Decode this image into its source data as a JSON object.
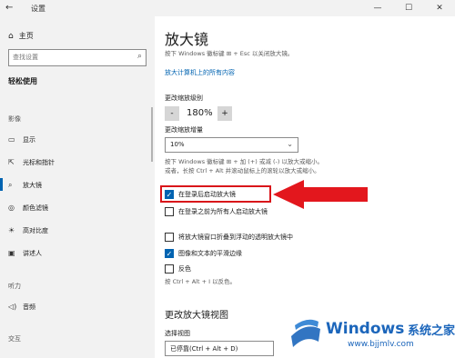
{
  "window": {
    "back_icon": "back-arrow-icon",
    "title": "设置",
    "minimize": "—",
    "maximize": "☐",
    "close": "✕"
  },
  "sidebar": {
    "home_icon": "home-icon",
    "home_label": "主页",
    "search_placeholder": "查找设置",
    "search_icon": "search-icon",
    "section_title": "轻松使用",
    "groups": [
      {
        "label": "影像"
      },
      {
        "label": "听力"
      },
      {
        "label": "音频"
      },
      {
        "label": "交互"
      }
    ],
    "items": [
      {
        "icon": "display-icon",
        "label": "显示"
      },
      {
        "icon": "cursor-icon",
        "label": "光标和指针"
      },
      {
        "icon": "magnifier-icon",
        "label": "放大镜"
      },
      {
        "icon": "color-filter-icon",
        "label": "颜色滤镜"
      },
      {
        "icon": "contrast-icon",
        "label": "高对比度"
      },
      {
        "icon": "narrator-icon",
        "label": "讲述人"
      },
      {
        "icon": "audio-icon",
        "label": "音频"
      }
    ]
  },
  "main": {
    "title": "放大镜",
    "intro": "按下 Windows 徽标键 ⊞ + Esc 以关闭放大镜。",
    "link": "放大计算机上的所有内容",
    "zoom_level_label": "更改缩放级别",
    "zoom_minus": "-",
    "zoom_value": "180%",
    "zoom_plus": "+",
    "increment_label": "更改缩放增量",
    "increment_value": "10%",
    "increment_desc_1": "按下 Windows 徽标键 ⊞ + 加 (+) 或减 (-) 以放大或缩小。",
    "increment_desc_2": "或者，长按 Ctrl + Alt 并滚动鼠标上的滚轮以放大或缩小。",
    "checkboxes": [
      {
        "label": "在登录后启动放大镜",
        "checked": true
      },
      {
        "label": "在登录之前为所有人启动放大镜",
        "checked": false
      },
      {
        "label": "将放大镜窗口折叠到浮动的透明放大镜中",
        "checked": false
      },
      {
        "label": "图像和文本的平滑边缘",
        "checked": true
      },
      {
        "label": "反色",
        "checked": false
      }
    ],
    "invert_hint": "按 Ctrl + Alt + I 以反色。",
    "view_heading": "更改放大镜视图",
    "view_label": "选择视图",
    "view_value": "已停靠(Ctrl + Alt + D)"
  },
  "colors": {
    "accent": "#0063b1",
    "highlight": "#d9151a",
    "watermark": "#1c66bb"
  },
  "watermark": {
    "brand": "Windows",
    "cn": "系统之家",
    "url": "www.bjjmlv.com"
  }
}
